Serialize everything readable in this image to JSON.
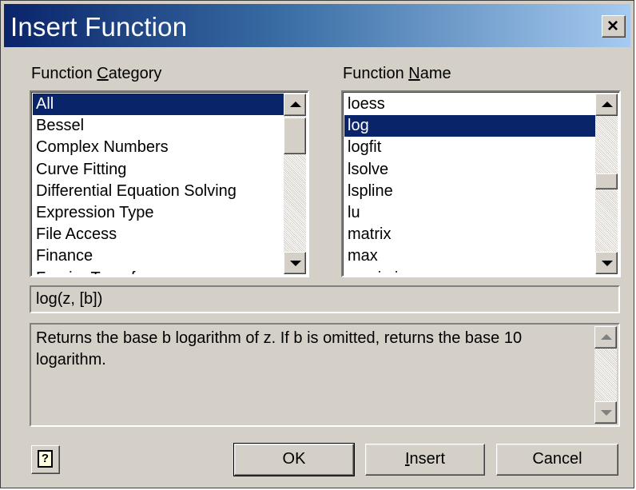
{
  "window": {
    "title": "Insert Function",
    "close_glyph": "×",
    "close_icon": "close-icon"
  },
  "category": {
    "label_pre": "Function ",
    "label_mnemonic": "C",
    "label_post": "ategory",
    "items": [
      "All",
      "Bessel",
      "Complex Numbers",
      "Curve Fitting",
      "Differential Equation Solving",
      "Expression Type",
      "File Access",
      "Finance",
      "Fourier Transform"
    ],
    "selected_index": 0
  },
  "function_name": {
    "label_pre": "Function ",
    "label_mnemonic": "N",
    "label_post": "ame",
    "items": [
      "loess",
      "log",
      "logfit",
      "lsolve",
      "lspline",
      "lu",
      "matrix",
      "max",
      "maximize"
    ],
    "selected_index": 1
  },
  "syntax": "log(z, [b])",
  "description": "Returns the base b logarithm of z. If b is omitted, returns the base 10 logarithm.",
  "buttons": {
    "ok": "OK",
    "insert_mnemonic": "I",
    "insert_rest": "nsert",
    "cancel": "Cancel",
    "help_glyph": "?",
    "help_icon": "help-icon"
  },
  "colors": {
    "title_gradient_start": "#0a246a",
    "title_gradient_end": "#a6caf0",
    "selection": "#0a246a",
    "dialog_face": "#d4d0c8"
  }
}
